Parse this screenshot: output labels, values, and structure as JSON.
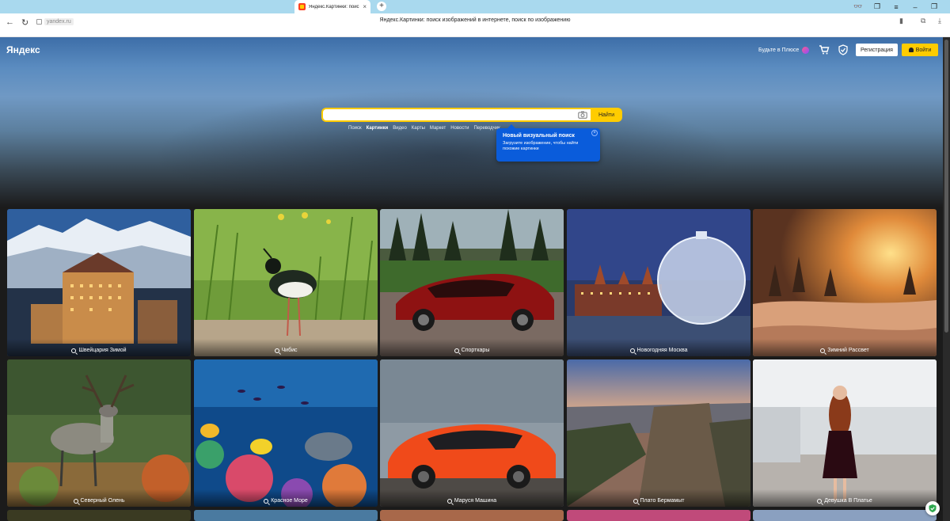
{
  "browser": {
    "tab_title": "Яндекс.Картинки: поис",
    "url": "yandex.ru",
    "page_title": "Яндекс.Картинки: поиск изображений в интернете, поиск по изображению"
  },
  "header": {
    "logo": "Яндекс",
    "plus_link": "Будьте в Плюсе",
    "register_label": "Регистрация",
    "login_label": "Войти"
  },
  "search": {
    "value": "",
    "button_label": "Найти"
  },
  "services": [
    "Поиск",
    "Картинки",
    "Видео",
    "Карты",
    "Маркет",
    "Новости",
    "Переводчик"
  ],
  "active_service": "Картинки",
  "tooltip": {
    "title": "Новый визуальный поиск",
    "text": "Загрузите изображение, чтобы найти похожие картинки"
  },
  "tiles": [
    {
      "caption": "Швейцария Зимой",
      "icon": "search-icon"
    },
    {
      "caption": "Чибис",
      "icon": "search-icon"
    },
    {
      "caption": "Спорткары",
      "icon": "search-icon"
    },
    {
      "caption": "Новогодняя Москва",
      "icon": "search-icon"
    },
    {
      "caption": "Зимний Рассвет",
      "icon": "search-icon"
    },
    {
      "caption": "Северный Олень",
      "icon": "search-icon"
    },
    {
      "caption": "Красное Море",
      "icon": "search-icon"
    },
    {
      "caption": "Маруся Машина",
      "icon": "search-icon"
    },
    {
      "caption": "Плато Бермамыт",
      "icon": "search-icon"
    },
    {
      "caption": "Девушка В Платье",
      "icon": "search-icon"
    }
  ],
  "colors": {
    "accent_yellow": "#ffcc00",
    "tooltip_blue": "#0a5cdb",
    "tab_strip": "#a9d9ee"
  }
}
